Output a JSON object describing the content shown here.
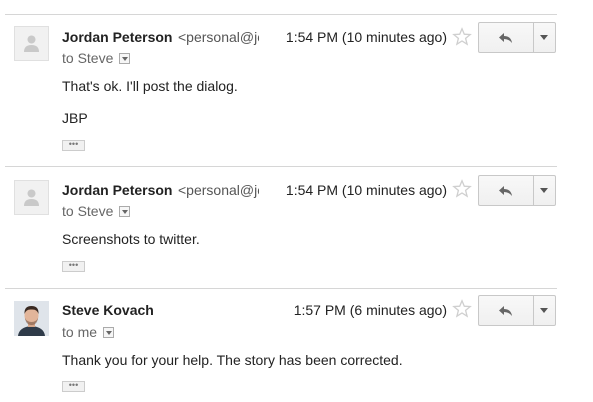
{
  "messages": [
    {
      "sender": "Jordan Peterson",
      "email": "<personal@jordanbpeterson.com>",
      "time": "1:54 PM (10 minutes ago)",
      "to": "to Steve",
      "body": [
        "That's ok. I'll post the dialog.",
        "JBP"
      ],
      "avatar": "default-person-icon"
    },
    {
      "sender": "Jordan Peterson",
      "email": "<personal@jordanbpeterson.com>",
      "time": "1:54 PM (10 minutes ago)",
      "to": "to Steve",
      "body": [
        "Screenshots to twitter."
      ],
      "avatar": "default-person-icon"
    },
    {
      "sender": "Steve Kovach",
      "email": "",
      "time": "1:57 PM (6 minutes ago)",
      "to": "to me",
      "body": [
        "Thank you for your help. The story has been corrected."
      ],
      "avatar": "profile-photo"
    }
  ],
  "ellipsis_label": "•••",
  "icons": {
    "star": "star-icon",
    "reply": "reply-arrow-icon",
    "more": "dropdown-caret-icon"
  },
  "colors": {
    "divider": "#d6d6d6",
    "button_border": "#c8c8c8",
    "text": "#222222",
    "muted": "#666666"
  }
}
